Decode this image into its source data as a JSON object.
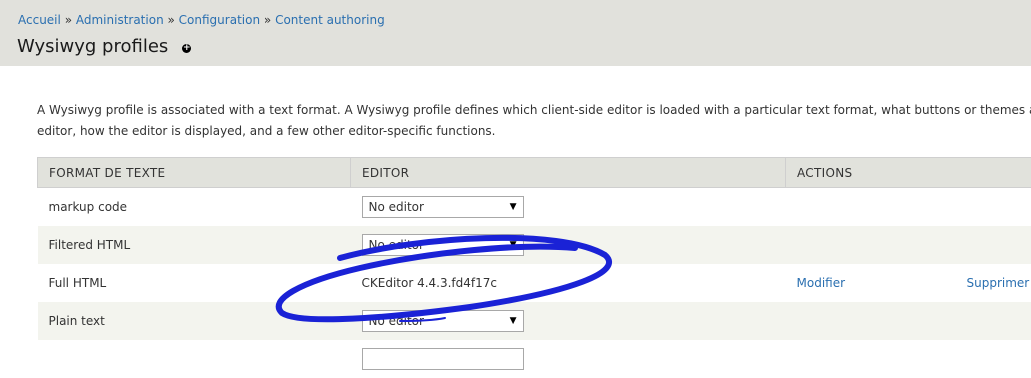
{
  "breadcrumb": {
    "items": [
      "Accueil",
      "Administration",
      "Configuration",
      "Content authoring"
    ],
    "separator": "»"
  },
  "page": {
    "title": "Wysiwyg profiles",
    "description_line1": "A Wysiwyg profile is associated with a text format. A Wysiwyg profile defines which client-side editor is loaded with a particular text format, what buttons or themes are enal",
    "description_line2": "editor, how the editor is displayed, and a few other editor-specific functions."
  },
  "table": {
    "headers": [
      "FORMAT DE TEXTE",
      "EDITOR",
      "ACTIONS"
    ],
    "rows": [
      {
        "format": "markup code",
        "editor": "No editor",
        "type": "select"
      },
      {
        "format": "Filtered HTML",
        "editor": "No editor",
        "type": "select"
      },
      {
        "format": "Full HTML",
        "editor": "CKEditor 4.4.3.fd4f17c",
        "type": "text",
        "edit": "Modifier",
        "delete": "Supprimer"
      },
      {
        "format": "Plain text",
        "editor": "No editor",
        "type": "select"
      },
      {
        "format": "",
        "editor": "",
        "type": "select"
      }
    ]
  },
  "colors": {
    "header_bg": "#e1e1dc",
    "link": "#2a6fb0",
    "annotation_stroke": "#1a22d6"
  }
}
